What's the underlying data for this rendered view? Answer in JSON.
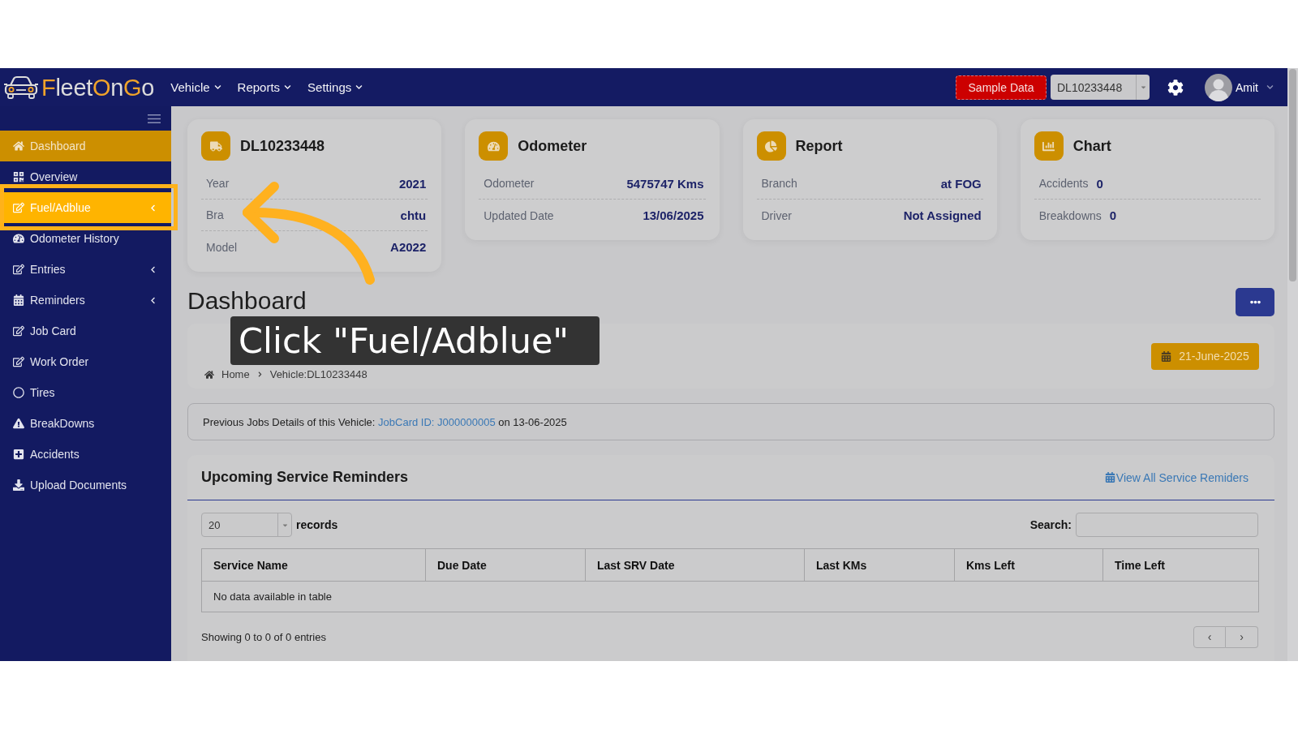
{
  "header": {
    "logo": [
      {
        "text": "F",
        "color": "#f0a32a"
      },
      {
        "text": "leet",
        "color": "#dcdcdc"
      },
      {
        "text": "O",
        "color": "#f0a32a"
      },
      {
        "text": "n",
        "color": "#dcdcdc"
      },
      {
        "text": "G",
        "color": "#f0a32a"
      },
      {
        "text": "o",
        "color": "#dcdcdc"
      }
    ],
    "menus": [
      "Vehicle",
      "Reports",
      "Settings"
    ],
    "sample_button": "Sample Data",
    "vehicle_select": {
      "value": "DL10233448"
    },
    "user": {
      "name": "Amit"
    }
  },
  "sidebar": {
    "items": [
      {
        "label": "Dashboard",
        "kind": "link",
        "selected": true,
        "highlighted": false
      },
      {
        "label": "Overview",
        "kind": "link",
        "selected": false,
        "highlighted": false
      },
      {
        "label": "Fuel/Adblue",
        "kind": "group",
        "selected": false,
        "highlighted": true
      },
      {
        "label": "Odometer History",
        "kind": "link",
        "selected": false,
        "highlighted": false
      },
      {
        "label": "Entries",
        "kind": "group",
        "selected": false,
        "highlighted": false
      },
      {
        "label": "Reminders",
        "kind": "group",
        "selected": false,
        "highlighted": false
      },
      {
        "label": "Job Card",
        "kind": "link",
        "selected": false,
        "highlighted": false
      },
      {
        "label": "Work Order",
        "kind": "link",
        "selected": false,
        "highlighted": false
      },
      {
        "label": "Tires",
        "kind": "link",
        "selected": false,
        "highlighted": false
      },
      {
        "label": "BreakDowns",
        "kind": "link",
        "selected": false,
        "highlighted": false
      },
      {
        "label": "Accidents",
        "kind": "link",
        "selected": false,
        "highlighted": false
      },
      {
        "label": "Upload Documents",
        "kind": "link",
        "selected": false,
        "highlighted": false
      }
    ]
  },
  "cards": [
    {
      "title": "DL10233448",
      "kind": "details",
      "rows": [
        {
          "label": "Year",
          "value": "2021"
        },
        {
          "label": "Bra",
          "value": "chtu"
        },
        {
          "label": "Model",
          "value": "A2022"
        }
      ]
    },
    {
      "title": "Odometer",
      "kind": "details",
      "rows": [
        {
          "label": "Odometer",
          "value": "5475747 Kms"
        },
        {
          "label": "Updated Date",
          "value": "13/06/2025"
        }
      ]
    },
    {
      "title": "Report",
      "kind": "details",
      "rows": [
        {
          "label": "Branch",
          "value": "at FOG"
        },
        {
          "label": "Driver",
          "value": "Not Assigned"
        }
      ]
    },
    {
      "title": "Chart",
      "kind": "counts",
      "rows": [
        {
          "label": "Accidents",
          "value": "0"
        },
        {
          "label": "Breakdowns",
          "value": "0"
        }
      ]
    }
  ],
  "page": {
    "title": "Dashboard",
    "breadcrumb": [
      "Home",
      "Vehicle:DL10233448"
    ],
    "date": "21-June-2025"
  },
  "notice": {
    "text": "Previous Jobs Details of this Vehicle:",
    "link": "JobCard ID: J000000005",
    "suffix": "on 13-06-2025"
  },
  "reminders": {
    "title": "Upcoming Service Reminders",
    "link": "View All Service Remiders",
    "page_size": "20",
    "records_label": "records",
    "search_label": "Search:",
    "columns": [
      "Service Name",
      "Due Date",
      "Last SRV Date",
      "Last KMs",
      "Kms Left",
      "Time Left"
    ],
    "empty_message": "No data available in table",
    "summary": "Showing 0 to 0 of 0 entries",
    "pager": [
      "‹",
      "›"
    ]
  },
  "guide": {
    "tooltip": "Click \"Fuel/Adblue\""
  }
}
